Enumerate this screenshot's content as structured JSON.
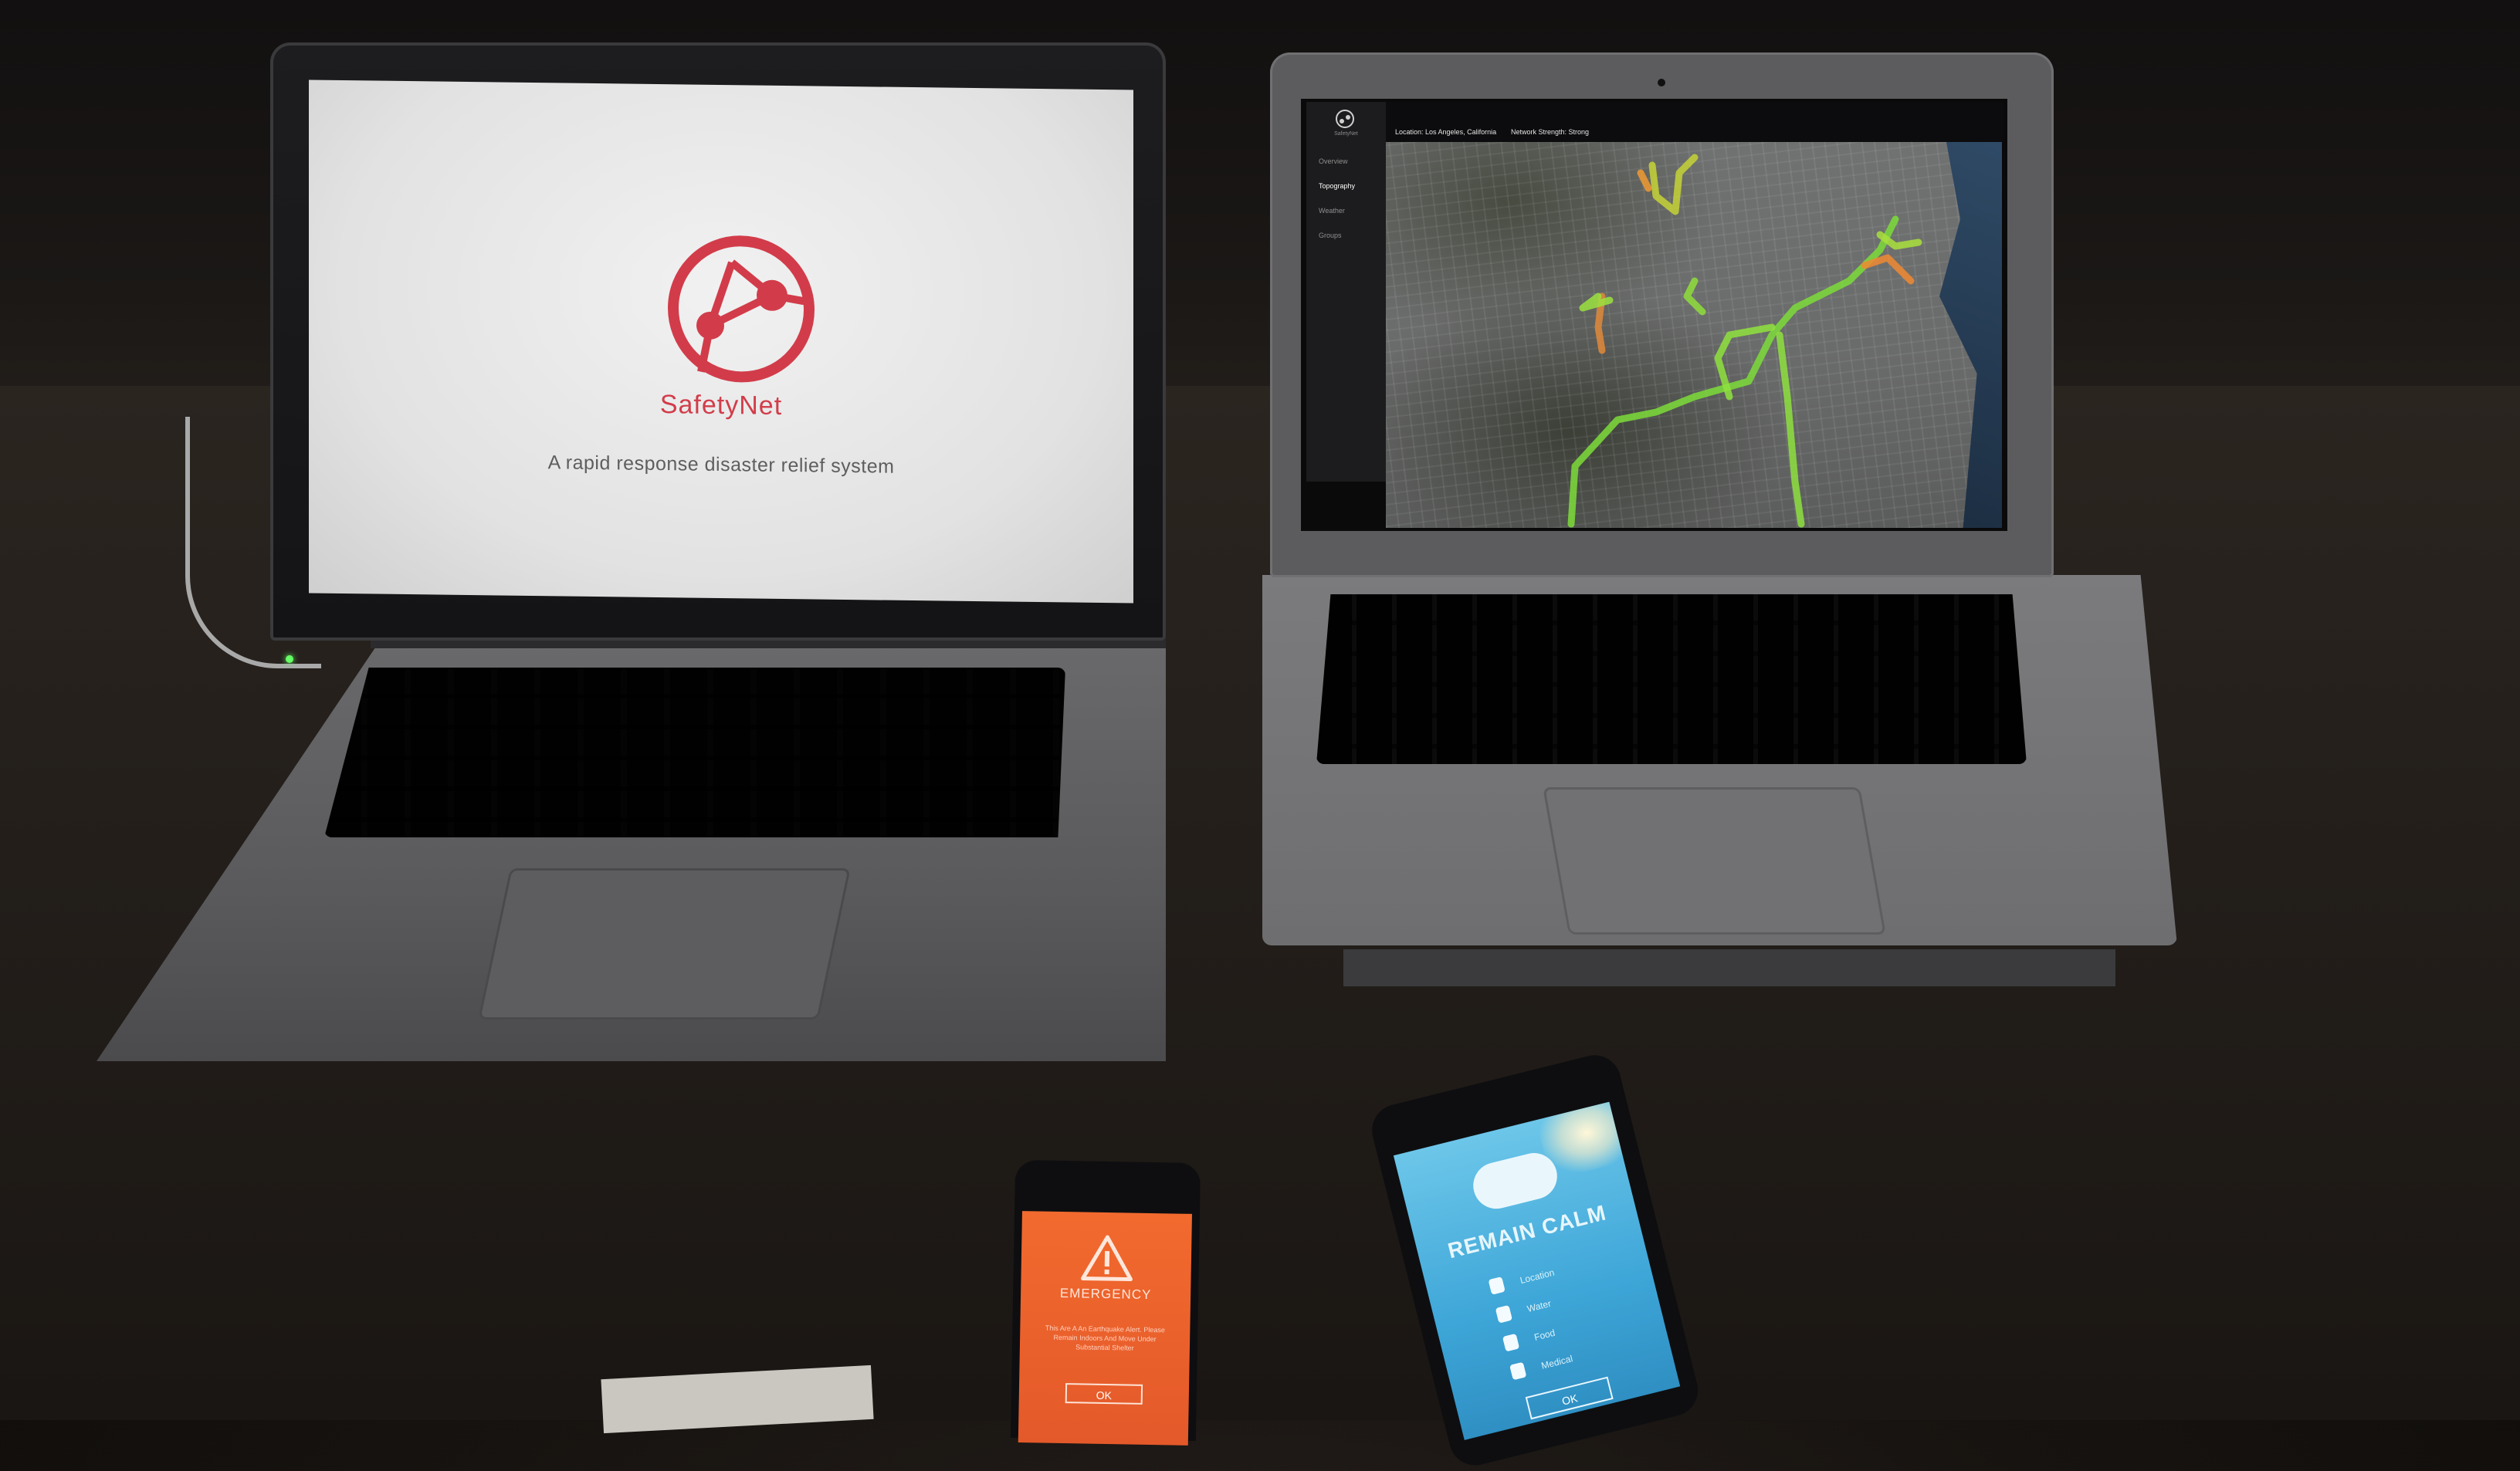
{
  "left_laptop": {
    "app_title": "SafetyNet",
    "tagline": "A rapid response disaster relief system",
    "accent_color": "#d23c4a"
  },
  "right_laptop": {
    "brand": "SafetyNet",
    "location": "Location: Los Angeles, California",
    "network": "Network Strength: Strong",
    "nav": [
      "Overview",
      "Topography",
      "Weather",
      "Groups"
    ],
    "active_nav": "Topography"
  },
  "phone_emergency": {
    "title": "EMERGENCY",
    "message": "This Are A An Earthquake Alert. Please Remain Indoors And Move Under Substantial Shelter",
    "button": "OK",
    "color": "#f26a2e"
  },
  "phone_calm": {
    "title": "REMAIN CALM",
    "items": [
      "Location",
      "Water",
      "Food",
      "Medical"
    ],
    "button": "OK",
    "color": "#3ea6d8"
  }
}
